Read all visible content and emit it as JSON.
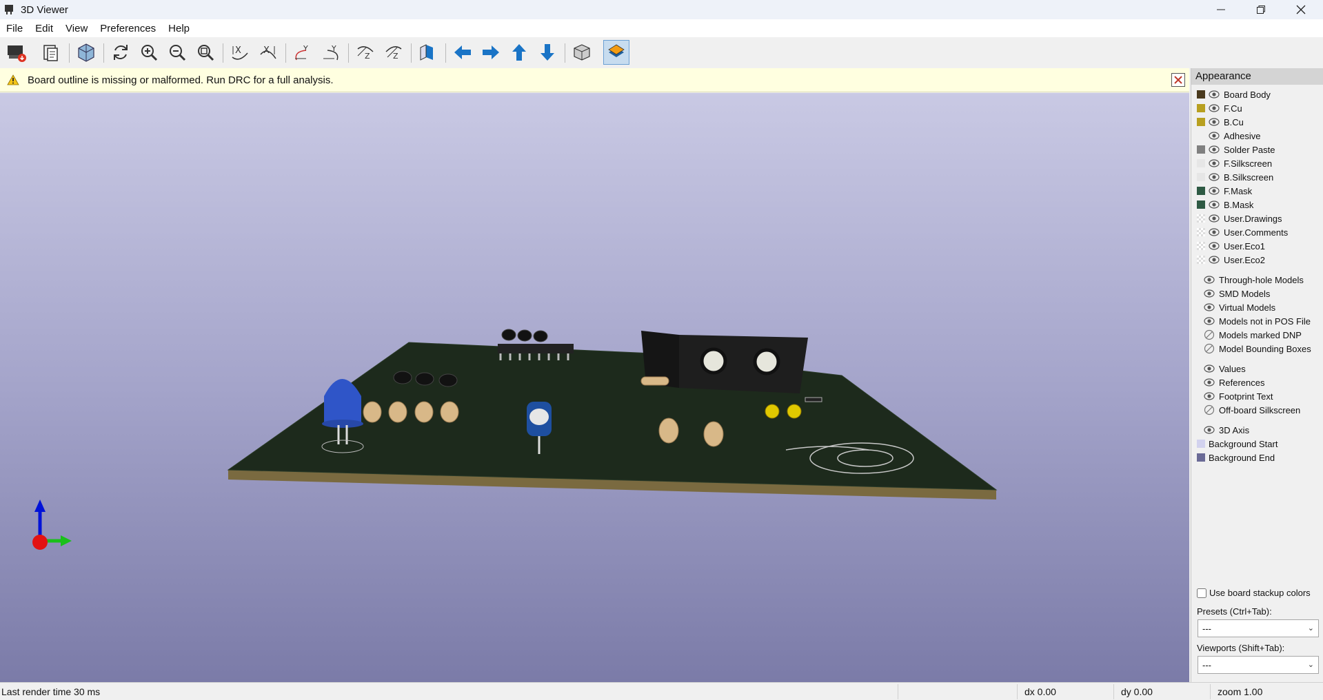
{
  "window": {
    "title": "3D Viewer"
  },
  "menu": {
    "items": [
      "File",
      "Edit",
      "View",
      "Preferences",
      "Help"
    ]
  },
  "toolbar": {
    "buttons": [
      "export-image",
      "copy-clipboard",
      "raytrace-view",
      "reload",
      "zoom-in",
      "zoom-out",
      "zoom-fit",
      "rotate-x-cw",
      "rotate-x-ccw",
      "rotate-y-cw",
      "rotate-y-ccw",
      "rotate-z-cw",
      "rotate-z-ccw",
      "flip-board",
      "move-left",
      "move-right",
      "move-up",
      "move-down",
      "orthographic",
      "appearance-manager"
    ],
    "active": "appearance-manager"
  },
  "infobar": {
    "message": "Board outline is missing or malformed. Run DRC for a full analysis."
  },
  "appearance": {
    "title": "Appearance",
    "layers": [
      {
        "label": "Board Body",
        "color": "#4a3a1e",
        "visible": true
      },
      {
        "label": "F.Cu",
        "color": "#b8a020",
        "visible": true
      },
      {
        "label": "B.Cu",
        "color": "#b8a020",
        "visible": true
      },
      {
        "label": "Adhesive",
        "color": "",
        "visible": true
      },
      {
        "label": "Solder Paste",
        "color": "#808080",
        "visible": true
      },
      {
        "label": "F.Silkscreen",
        "color": "#e6e6e6",
        "visible": true
      },
      {
        "label": "B.Silkscreen",
        "color": "#e6e6e6",
        "visible": true
      },
      {
        "label": "F.Mask",
        "color": "#2e5a44",
        "visible": true
      },
      {
        "label": "B.Mask",
        "color": "#2e5a44",
        "visible": true
      },
      {
        "label": "User.Drawings",
        "color": "checker",
        "visible": true
      },
      {
        "label": "User.Comments",
        "color": "checker",
        "visible": true
      },
      {
        "label": "User.Eco1",
        "color": "checker",
        "visible": true
      },
      {
        "label": "User.Eco2",
        "color": "checker",
        "visible": true
      }
    ],
    "models": [
      {
        "label": "Through-hole Models",
        "visible": true
      },
      {
        "label": "SMD Models",
        "visible": true
      },
      {
        "label": "Virtual Models",
        "visible": true
      },
      {
        "label": "Models not in POS File",
        "visible": true
      },
      {
        "label": "Models marked DNP",
        "visible": false
      },
      {
        "label": "Model Bounding Boxes",
        "visible": false
      }
    ],
    "text": [
      {
        "label": "Values",
        "visible": true
      },
      {
        "label": "References",
        "visible": true
      },
      {
        "label": "Footprint Text",
        "visible": true
      },
      {
        "label": "Off-board Silkscreen",
        "visible": false
      }
    ],
    "other": [
      {
        "label": "3D Axis",
        "visible": true,
        "color": ""
      },
      {
        "label": "Background Start",
        "visible": null,
        "color": "#d2d2ee"
      },
      {
        "label": "Background End",
        "visible": null,
        "color": "#6a6a96"
      }
    ],
    "stackup_checkbox": {
      "label": "Use board stackup colors",
      "checked": false
    },
    "presets": {
      "label": "Presets (Ctrl+Tab):",
      "value": "---"
    },
    "viewports": {
      "label": "Viewports (Shift+Tab):",
      "value": "---"
    }
  },
  "status": {
    "render_time": "Last render time 30 ms",
    "dx": "dx 0.00",
    "dy": "dy 0.00",
    "zoom": "zoom 1.00"
  }
}
